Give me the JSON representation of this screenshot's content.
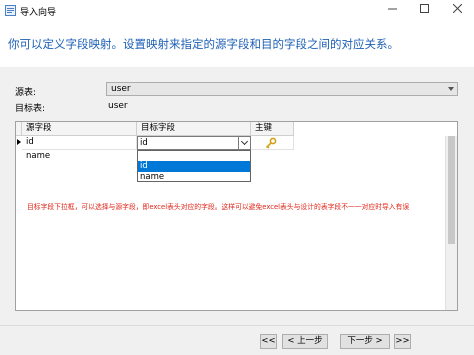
{
  "window": {
    "title": "导入向导",
    "icon": "import-wizard-icon",
    "controls": [
      "minimize-icon",
      "maximize-icon",
      "close-icon"
    ]
  },
  "header": {
    "instruction": "你可以定义字段映射。设置映射来指定的源字段和目的字段之间的对应关系。"
  },
  "source_table": {
    "label": "源表:",
    "value": "user"
  },
  "target_table": {
    "label": "目标表:",
    "value": "user"
  },
  "grid": {
    "columns": [
      "源字段",
      "目标字段",
      "主键"
    ],
    "rows": [
      {
        "source": "id",
        "target": "id",
        "primary_key": true,
        "current": true
      },
      {
        "source": "name",
        "target": "",
        "primary_key": false,
        "current": false
      }
    ],
    "dropdown_options": [
      "id",
      "name"
    ],
    "dropdown_selected": "id"
  },
  "annotation": "目标字段下拉框，可以选择与源字段，即excel表头对应的字段。这样可以避免excel表头与设计的表字段不一一对应时导入有误",
  "footer": {
    "first": "<<",
    "prev": "< 上一步",
    "next": "下一步 >",
    "last": ">>"
  },
  "colors": {
    "header_text": "#1c5fb5",
    "annotation": "#e0261a",
    "selection": "#0078d7",
    "key": "#d4a017"
  }
}
